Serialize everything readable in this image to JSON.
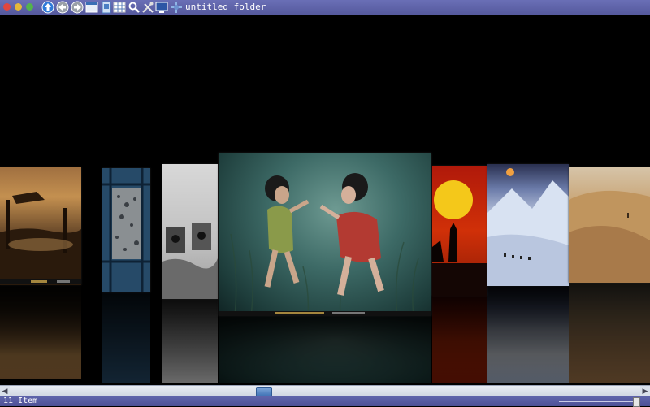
{
  "window": {
    "title": "untitled folder"
  },
  "toolbar": {
    "icons": [
      "up-arrow-icon",
      "back-icon",
      "forward-icon",
      "browser-icon",
      "document-icon",
      "grid-view-icon",
      "search-icon",
      "tools-icon",
      "monitor-icon",
      "transform-icon"
    ]
  },
  "coverflow": {
    "items": [
      {
        "name": "fishermen-sunset-photo"
      },
      {
        "name": "stone-texture-photo"
      },
      {
        "name": "bw-art-photo"
      },
      {
        "name": "underwater-women-photo"
      },
      {
        "name": "sun-silhouette-photo"
      },
      {
        "name": "snow-mountain-photo"
      },
      {
        "name": "desert-dunes-photo"
      }
    ]
  },
  "scrollbar": {
    "left_arrow": "◀",
    "right_arrow": "▶"
  },
  "status": {
    "item_count": "11 Item"
  },
  "colors": {
    "toolbar": "#5f64ab",
    "scroll_thumb": "#3c6fb3",
    "background": "#000000"
  }
}
